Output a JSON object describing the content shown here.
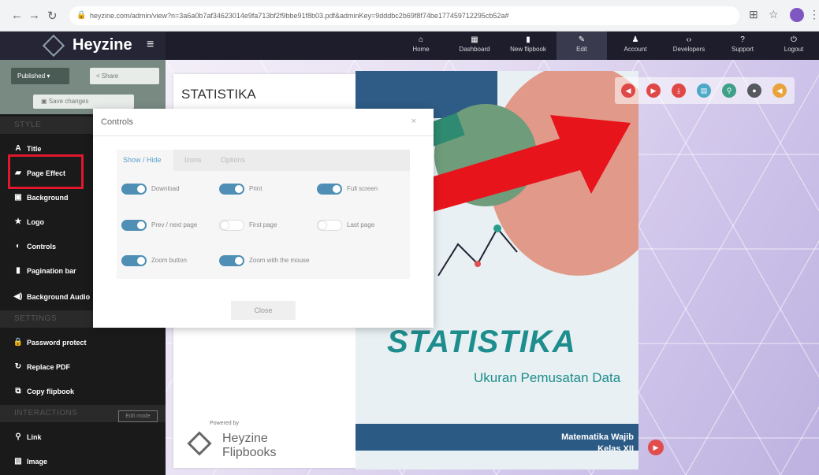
{
  "browser": {
    "url": "heyzine.com/admin/view?n=3a6a0b7af34623014e9fa713bf2f9bbe91f8b03.pdf&adminKey=9dddbc2b69f8f74be177459712295cb52a#",
    "icons": [
      "back-icon",
      "forward-icon",
      "reload-icon",
      "lock-icon",
      "translate-icon",
      "star-icon",
      "profile-icon",
      "kebab-icon"
    ]
  },
  "brand": {
    "name": "Heyzine",
    "menu_glyph": "≡"
  },
  "topnav": [
    {
      "label": "Home",
      "glyph": "⌂"
    },
    {
      "label": "Dashboard",
      "glyph": "▦"
    },
    {
      "label": "New flipbook",
      "glyph": "▮"
    },
    {
      "label": "Edit",
      "glyph": "✎"
    },
    {
      "label": "Account",
      "glyph": "♟"
    },
    {
      "label": "Developers",
      "glyph": "‹›"
    },
    {
      "label": "Support",
      "glyph": "?"
    },
    {
      "label": "Logout",
      "glyph": "⏻"
    }
  ],
  "sidebar": {
    "published_label": "Published ▾",
    "share_label": "Share",
    "save_label": "Save changes",
    "style_header": "STYLE",
    "style_items": [
      {
        "label": "Title",
        "glyph": "A"
      },
      {
        "label": "Page Effect",
        "glyph": "▰"
      },
      {
        "label": "Background",
        "glyph": "▣"
      },
      {
        "label": "Logo",
        "glyph": "★"
      },
      {
        "label": "Controls",
        "glyph": "◐"
      },
      {
        "label": "Pagination bar",
        "glyph": "▮"
      },
      {
        "label": "Background Audio",
        "glyph": "◀)"
      }
    ],
    "settings_header": "SETTINGS",
    "settings_items": [
      {
        "label": "Password protect",
        "glyph": "🔒"
      },
      {
        "label": "Replace PDF",
        "glyph": "↻"
      },
      {
        "label": "Copy flipbook",
        "glyph": "⧉"
      }
    ],
    "interactions_header": "INTERACTIONS",
    "edit_mode_label": "Edit mode",
    "interaction_items": [
      {
        "label": "Link",
        "glyph": "⚲"
      },
      {
        "label": "Image",
        "glyph": "▨"
      }
    ]
  },
  "book": {
    "left_title": "STATISTIKA",
    "powered_by": "Powered by",
    "powered_brand": "Heyzine\nFlipbooks",
    "cover_title": "STATISTIKA",
    "cover_subtitle": "Ukuran Pemusatan Data",
    "cover_footer": "Matematika Wajib\nKelas XII"
  },
  "flipbook_controls": [
    {
      "name": "prev-control",
      "glyph": "◀",
      "color": "#e04848"
    },
    {
      "name": "next-control",
      "glyph": "▶",
      "color": "#e04848"
    },
    {
      "name": "download-control",
      "glyph": "⤓",
      "color": "#e04848"
    },
    {
      "name": "print-control",
      "glyph": "▤",
      "color": "#4ea8c8"
    },
    {
      "name": "zoom-control",
      "glyph": "⚲",
      "color": "#3fa089"
    },
    {
      "name": "fullscreen-control",
      "glyph": "●",
      "color": "#55585e"
    },
    {
      "name": "sound-control",
      "glyph": "◀",
      "color": "#e8a33d"
    }
  ],
  "modal": {
    "title": "Controls",
    "close_x": "×",
    "tabs": [
      "Show / Hide",
      "Icons",
      "Options"
    ],
    "active_tab": "Show / Hide",
    "options": [
      {
        "label": "Download",
        "on": true
      },
      {
        "label": "Print",
        "on": true
      },
      {
        "label": "Full screen",
        "on": true
      },
      {
        "label": "Prev / next page",
        "on": true
      },
      {
        "label": "First page",
        "on": false
      },
      {
        "label": "Last page",
        "on": false
      },
      {
        "label": "Zoom button",
        "on": true
      },
      {
        "label": "Zoom with the mouse",
        "on": true
      }
    ],
    "close_label": "Close"
  },
  "colors": {
    "accent": "#4f8eb5",
    "highlight": "#e0182e",
    "nav_bg": "#1d1d2b"
  }
}
